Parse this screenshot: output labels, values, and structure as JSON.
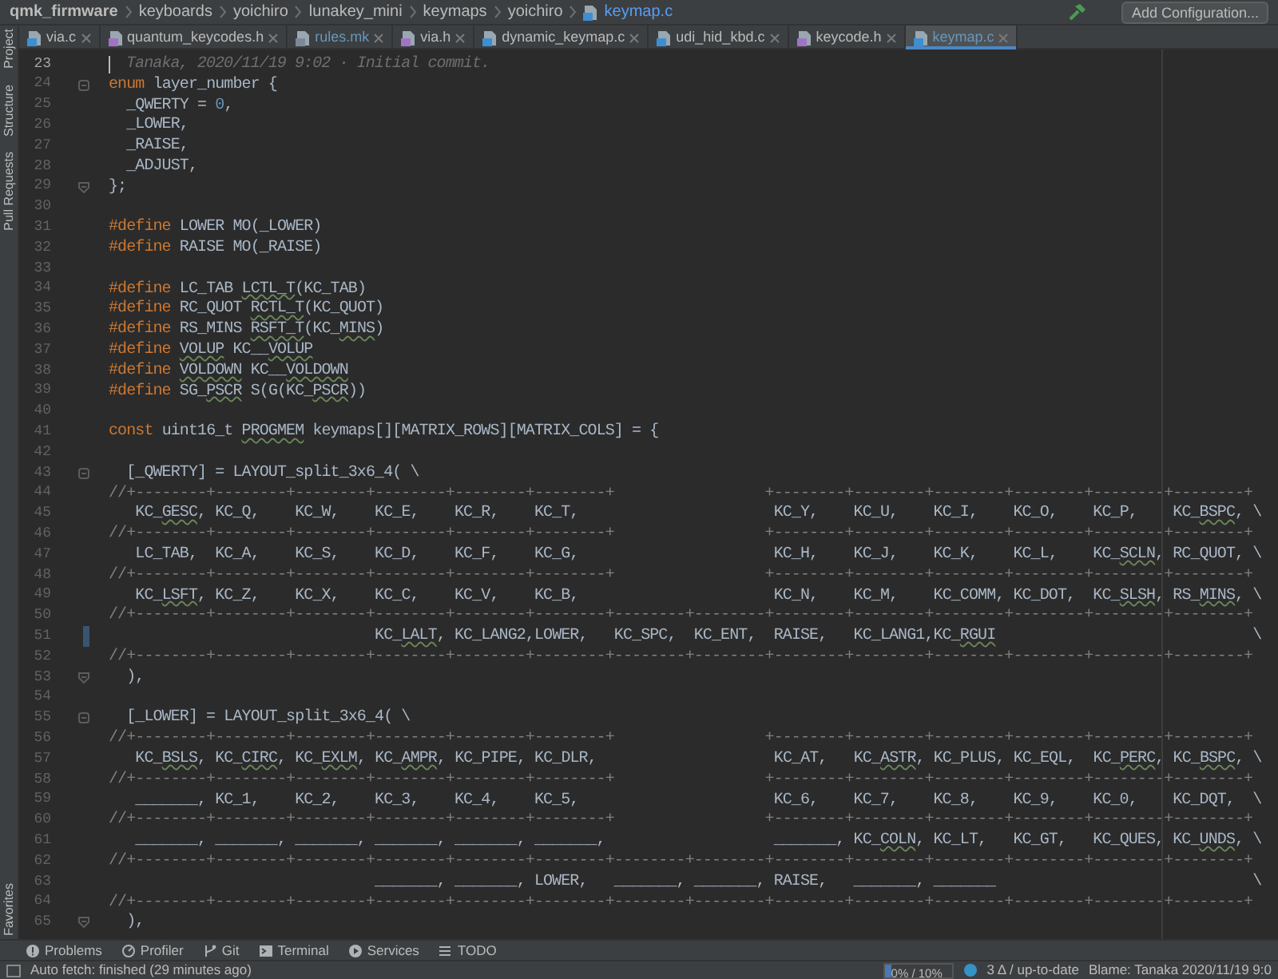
{
  "breadcrumb": [
    {
      "label": "qmk_firmware",
      "kind": "root"
    },
    {
      "label": "keyboards",
      "kind": "folder"
    },
    {
      "label": "yoichiro",
      "kind": "folder"
    },
    {
      "label": "lunakey_mini",
      "kind": "folder"
    },
    {
      "label": "keymaps",
      "kind": "folder"
    },
    {
      "label": "yoichiro",
      "kind": "folder"
    },
    {
      "label": "keymap.c",
      "kind": "file"
    }
  ],
  "run_config": {
    "button": "Add Configuration..."
  },
  "tabs": [
    {
      "label": "via.c",
      "kind": "c",
      "selected": false,
      "modified": false
    },
    {
      "label": "quantum_keycodes.h",
      "kind": "h",
      "selected": false,
      "modified": false
    },
    {
      "label": "rules.mk",
      "kind": "mk",
      "selected": false,
      "modified": true
    },
    {
      "label": "via.h",
      "kind": "h",
      "selected": false,
      "modified": false
    },
    {
      "label": "dynamic_keymap.c",
      "kind": "c",
      "selected": false,
      "modified": false
    },
    {
      "label": "udi_hid_kbd.c",
      "kind": "c",
      "selected": false,
      "modified": false
    },
    {
      "label": "keycode.h",
      "kind": "h",
      "selected": false,
      "modified": false
    },
    {
      "label": "keymap.c",
      "kind": "c",
      "selected": true,
      "modified": true
    }
  ],
  "side_tools_top": [
    "Project",
    "Structure",
    "Pull Requests"
  ],
  "side_tools_bottom": [
    "Favorites"
  ],
  "editor": {
    "lines": [
      {
        "number": "23",
        "current": true,
        "changed": false,
        "parts": [
          {
            "kind": "blame",
            "text": "Tanaka, 2020/11/19 9:02 · Initial commit."
          }
        ]
      },
      {
        "number": "24",
        "current": false,
        "changed": false,
        "fold": {
          "kind": "start"
        },
        "parts": [
          {
            "kind": "keyword",
            "text": "enum"
          },
          {
            "kind": "code",
            "text": " layer_number {"
          }
        ]
      },
      {
        "number": "25",
        "current": false,
        "changed": false,
        "parts": [
          {
            "kind": "code",
            "text": "  _QWERTY = "
          },
          {
            "kind": "number",
            "text": "0"
          },
          {
            "kind": "code",
            "text": ","
          }
        ]
      },
      {
        "number": "26",
        "current": false,
        "changed": false,
        "parts": [
          {
            "kind": "code",
            "text": "  _LOWER,"
          }
        ]
      },
      {
        "number": "27",
        "current": false,
        "changed": false,
        "parts": [
          {
            "kind": "code",
            "text": "  _RAISE,"
          }
        ]
      },
      {
        "number": "28",
        "current": false,
        "changed": false,
        "parts": [
          {
            "kind": "code",
            "text": "  _ADJUST,"
          }
        ]
      },
      {
        "number": "29",
        "current": false,
        "changed": false,
        "fold": {
          "kind": "end"
        },
        "parts": [
          {
            "kind": "code",
            "text": "};"
          }
        ]
      },
      {
        "number": "30",
        "current": false,
        "changed": false
      },
      {
        "number": "31",
        "current": false,
        "changed": false,
        "parts": [
          {
            "kind": "keyword",
            "text": "#define"
          },
          {
            "kind": "code",
            "text": " LOWER MO(_LOWER)"
          }
        ]
      },
      {
        "number": "32",
        "current": false,
        "changed": false,
        "parts": [
          {
            "kind": "keyword",
            "text": "#define"
          },
          {
            "kind": "code",
            "text": " RAISE MO(_RAISE)"
          }
        ]
      },
      {
        "number": "33",
        "current": false,
        "changed": false
      },
      {
        "number": "34",
        "current": false,
        "changed": false,
        "parts": [
          {
            "kind": "keyword",
            "text": "#define"
          },
          {
            "kind": "code",
            "text": " LC_TAB "
          },
          {
            "kind": "warn",
            "text": "LCTL_T"
          },
          {
            "kind": "code",
            "text": "(KC_TAB)"
          }
        ]
      },
      {
        "number": "35",
        "current": false,
        "changed": false,
        "parts": [
          {
            "kind": "keyword",
            "text": "#define"
          },
          {
            "kind": "code",
            "text": " RC_QUOT "
          },
          {
            "kind": "warn",
            "text": "RCTL_T"
          },
          {
            "kind": "code",
            "text": "(KC_QUOT)"
          }
        ]
      },
      {
        "number": "36",
        "current": false,
        "changed": false,
        "parts": [
          {
            "kind": "keyword",
            "text": "#define"
          },
          {
            "kind": "code",
            "text": " RS_MINS "
          },
          {
            "kind": "warn",
            "text": "RSFT_T"
          },
          {
            "kind": "code",
            "text": "(KC_"
          },
          {
            "kind": "warn",
            "text": "MINS"
          },
          {
            "kind": "code",
            "text": ")"
          }
        ]
      },
      {
        "number": "37",
        "current": false,
        "changed": false,
        "parts": [
          {
            "kind": "keyword",
            "text": "#define "
          },
          {
            "kind": "warn",
            "text": "VOLUP"
          },
          {
            "kind": "code",
            "text": " KC__"
          },
          {
            "kind": "warn",
            "text": "VOLUP"
          }
        ]
      },
      {
        "number": "38",
        "current": false,
        "changed": false,
        "parts": [
          {
            "kind": "keyword",
            "text": "#define "
          },
          {
            "kind": "warn",
            "text": "VOLDOWN"
          },
          {
            "kind": "code",
            "text": " KC__"
          },
          {
            "kind": "warn",
            "text": "VOLDOWN"
          }
        ]
      },
      {
        "number": "39",
        "current": false,
        "changed": false,
        "parts": [
          {
            "kind": "keyword",
            "text": "#define"
          },
          {
            "kind": "code",
            "text": " SG_"
          },
          {
            "kind": "warn",
            "text": "PSCR"
          },
          {
            "kind": "code",
            "text": " S(G(KC_"
          },
          {
            "kind": "warn",
            "text": "PSCR"
          },
          {
            "kind": "code",
            "text": "))"
          }
        ]
      },
      {
        "number": "40",
        "current": false,
        "changed": false
      },
      {
        "number": "41",
        "current": false,
        "changed": false,
        "parts": [
          {
            "kind": "keyword",
            "text": "const"
          },
          {
            "kind": "code",
            "text": " uint16_t "
          },
          {
            "kind": "warn",
            "text": "PROGMEM"
          },
          {
            "kind": "code",
            "text": " keymaps[][MATRIX_ROWS][MATRIX_COLS] = {"
          }
        ]
      },
      {
        "number": "42",
        "current": false,
        "changed": false
      },
      {
        "number": "43",
        "current": false,
        "changed": false,
        "fold": {
          "kind": "start"
        },
        "parts": [
          {
            "kind": "code",
            "text": "  [_QWERTY] = LAYOUT_split_3x6_4( \\"
          }
        ]
      },
      {
        "number": "44",
        "current": false,
        "changed": false,
        "parts": [
          {
            "kind": "comment",
            "text": "//+--------+--------+--------+--------+--------+--------+                 +--------+--------+--------+--------+--------+--------+"
          }
        ]
      },
      {
        "number": "45",
        "current": false,
        "changed": false,
        "parts": [
          {
            "kind": "code",
            "text": "   KC_"
          },
          {
            "kind": "warn",
            "text": "GESC"
          },
          {
            "kind": "code",
            "text": ", KC_Q,    KC_W,    KC_E,    KC_R,    KC_T,                      KC_Y,    KC_U,    KC_I,    KC_O,    KC_P,    KC_"
          },
          {
            "kind": "warn",
            "text": "BSPC"
          },
          {
            "kind": "code",
            "text": ", \\"
          }
        ]
      },
      {
        "number": "46",
        "current": false,
        "changed": false,
        "parts": [
          {
            "kind": "comment",
            "text": "//+--------+--------+--------+--------+--------+--------+                 +--------+--------+--------+--------+--------+--------+"
          }
        ]
      },
      {
        "number": "47",
        "current": false,
        "changed": false,
        "parts": [
          {
            "kind": "code",
            "text": "   LC_TAB,  KC_A,    KC_S,    KC_D,    KC_F,    KC_G,                      KC_H,    KC_J,    KC_K,    KC_L,    KC_"
          },
          {
            "kind": "warn",
            "text": "SCLN"
          },
          {
            "kind": "code",
            "text": ", RC_QUOT, \\"
          }
        ]
      },
      {
        "number": "48",
        "current": false,
        "changed": false,
        "parts": [
          {
            "kind": "comment",
            "text": "//+--------+--------+--------+--------+--------+--------+                 +--------+--------+--------+--------+--------+--------+"
          }
        ]
      },
      {
        "number": "49",
        "current": false,
        "changed": false,
        "parts": [
          {
            "kind": "code",
            "text": "   KC_"
          },
          {
            "kind": "warn",
            "text": "LSFT"
          },
          {
            "kind": "code",
            "text": ", KC_Z,    KC_X,    KC_C,    KC_V,    KC_B,                      KC_N,    KC_M,    KC_COMM, KC_DOT,  KC_"
          },
          {
            "kind": "warn",
            "text": "SLSH"
          },
          {
            "kind": "code",
            "text": ", RS_"
          },
          {
            "kind": "warn",
            "text": "MINS"
          },
          {
            "kind": "code",
            "text": ", \\"
          }
        ]
      },
      {
        "number": "50",
        "current": false,
        "changed": false,
        "parts": [
          {
            "kind": "comment",
            "text": "//+--------+--------+--------+--------+--------+--------+--------+--------+--------+--------+--------+--------+--------+--------+"
          }
        ]
      },
      {
        "number": "51",
        "current": false,
        "changed": true,
        "parts": [
          {
            "kind": "code",
            "text": "                              KC_"
          },
          {
            "kind": "warn",
            "text": "LALT"
          },
          {
            "kind": "code",
            "text": ", KC_LANG2,LOWER,   KC_SPC,  KC_ENT,  RAISE,   KC_LANG1,KC_"
          },
          {
            "kind": "warn",
            "text": "RGUI"
          },
          {
            "kind": "code",
            "text": "                             \\"
          }
        ]
      },
      {
        "number": "52",
        "current": false,
        "changed": false,
        "parts": [
          {
            "kind": "comment",
            "text": "//+--------+--------+--------+--------+--------+--------+--------+--------+--------+--------+--------+--------+--------+--------+"
          }
        ]
      },
      {
        "number": "53",
        "current": false,
        "changed": false,
        "fold": {
          "kind": "end"
        },
        "parts": [
          {
            "kind": "code",
            "text": "  ),"
          }
        ]
      },
      {
        "number": "54",
        "current": false,
        "changed": false
      },
      {
        "number": "55",
        "current": false,
        "changed": false,
        "fold": {
          "kind": "start"
        },
        "parts": [
          {
            "kind": "code",
            "text": "  [_LOWER] = LAYOUT_split_3x6_4( \\"
          }
        ]
      },
      {
        "number": "56",
        "current": false,
        "changed": false,
        "parts": [
          {
            "kind": "comment",
            "text": "//+--------+--------+--------+--------+--------+--------+                 +--------+--------+--------+--------+--------+--------+"
          }
        ]
      },
      {
        "number": "57",
        "current": false,
        "changed": false,
        "parts": [
          {
            "kind": "code",
            "text": "   KC_"
          },
          {
            "kind": "warn",
            "text": "BSLS"
          },
          {
            "kind": "code",
            "text": ", KC_"
          },
          {
            "kind": "warn",
            "text": "CIRC"
          },
          {
            "kind": "code",
            "text": ", KC_"
          },
          {
            "kind": "warn",
            "text": "EXLM"
          },
          {
            "kind": "code",
            "text": ", KC_"
          },
          {
            "kind": "warn",
            "text": "AMPR"
          },
          {
            "kind": "code",
            "text": ", KC_PIPE, KC_DLR,                    KC_AT,   KC_"
          },
          {
            "kind": "warn",
            "text": "ASTR"
          },
          {
            "kind": "code",
            "text": ", KC_PLUS, KC_EQL,  KC_"
          },
          {
            "kind": "warn",
            "text": "PERC"
          },
          {
            "kind": "code",
            "text": ", KC_"
          },
          {
            "kind": "warn",
            "text": "BSPC"
          },
          {
            "kind": "code",
            "text": ", \\"
          }
        ]
      },
      {
        "number": "58",
        "current": false,
        "changed": false,
        "parts": [
          {
            "kind": "comment",
            "text": "//+--------+--------+--------+--------+--------+--------+                 +--------+--------+--------+--------+--------+--------+"
          }
        ]
      },
      {
        "number": "59",
        "current": false,
        "changed": false,
        "parts": [
          {
            "kind": "code",
            "text": "   _______, KC_1,    KC_2,    KC_3,    KC_4,    KC_5,                      KC_6,    KC_7,    KC_8,    KC_9,    KC_0,    KC_DQT,  \\"
          }
        ]
      },
      {
        "number": "60",
        "current": false,
        "changed": false,
        "parts": [
          {
            "kind": "comment",
            "text": "//+--------+--------+--------+--------+--------+--------+                 +--------+--------+--------+--------+--------+--------+"
          }
        ]
      },
      {
        "number": "61",
        "current": false,
        "changed": false,
        "parts": [
          {
            "kind": "code",
            "text": "   _______, _______, _______, _______, _______, _______,                   _______, KC_"
          },
          {
            "kind": "warn",
            "text": "COLN"
          },
          {
            "kind": "code",
            "text": ", KC_LT,   KC_GT,   KC_QUES, KC_"
          },
          {
            "kind": "warn",
            "text": "UNDS"
          },
          {
            "kind": "code",
            "text": ", \\"
          }
        ]
      },
      {
        "number": "62",
        "current": false,
        "changed": false,
        "parts": [
          {
            "kind": "comment",
            "text": "//+--------+--------+--------+--------+--------+--------+--------+--------+--------+--------+--------+--------+--------+--------+"
          }
        ]
      },
      {
        "number": "63",
        "current": false,
        "changed": false,
        "parts": [
          {
            "kind": "code",
            "text": "                              _______, _______, LOWER,   _______, _______, RAISE,   _______, _______                             \\"
          }
        ]
      },
      {
        "number": "64",
        "current": false,
        "changed": false,
        "parts": [
          {
            "kind": "comment",
            "text": "//+--------+--------+--------+--------+--------+--------+--------+--------+--------+--------+--------+--------+--------+--------+"
          }
        ]
      },
      {
        "number": "65",
        "current": false,
        "changed": false,
        "fold": {
          "kind": "end"
        },
        "parts": [
          {
            "kind": "code",
            "text": "  ),"
          }
        ]
      }
    ]
  },
  "tool_windows": [
    {
      "label": "Problems",
      "kind": "problems"
    },
    {
      "label": "Profiler",
      "kind": "profiler"
    },
    {
      "label": "Git",
      "kind": "git"
    },
    {
      "label": "Terminal",
      "kind": "terminal"
    },
    {
      "label": "Services",
      "kind": "services"
    },
    {
      "label": "TODO",
      "kind": "todo"
    }
  ],
  "status_bar": {
    "message": "Auto fetch: finished (29 minutes ago)",
    "memory": {
      "reading": "0% / 10%",
      "level": 0.1
    },
    "vcs": "3 Δ / up-to-date",
    "blame": "Blame: Tanaka 2020/11/19 9:0"
  }
}
